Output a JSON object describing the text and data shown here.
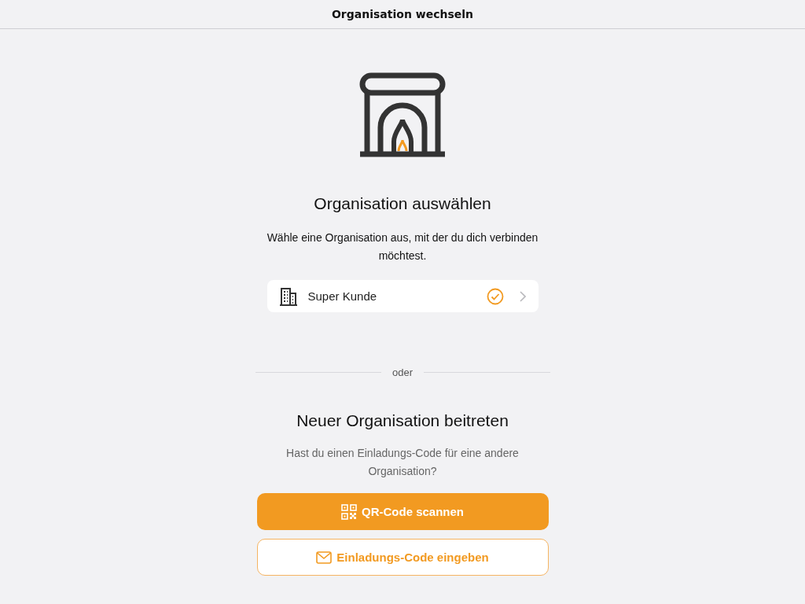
{
  "header": {
    "title": "Organisation wechseln"
  },
  "select_section": {
    "title": "Organisation auswählen",
    "description": "Wähle eine Organisation aus, mit der du dich verbinden möchtest."
  },
  "organisations": [
    {
      "name": "Super Kunde",
      "selected": true
    }
  ],
  "divider_label": "oder",
  "join_section": {
    "title": "Neuer Organisation beitreten",
    "description": "Hast du einen Einladungs-Code für eine andere Organisation?"
  },
  "buttons": [
    {
      "label": "QR-Code scannen",
      "kind": "primary"
    },
    {
      "label": "Einladungs-Code eingeben",
      "kind": "outline"
    }
  ]
}
